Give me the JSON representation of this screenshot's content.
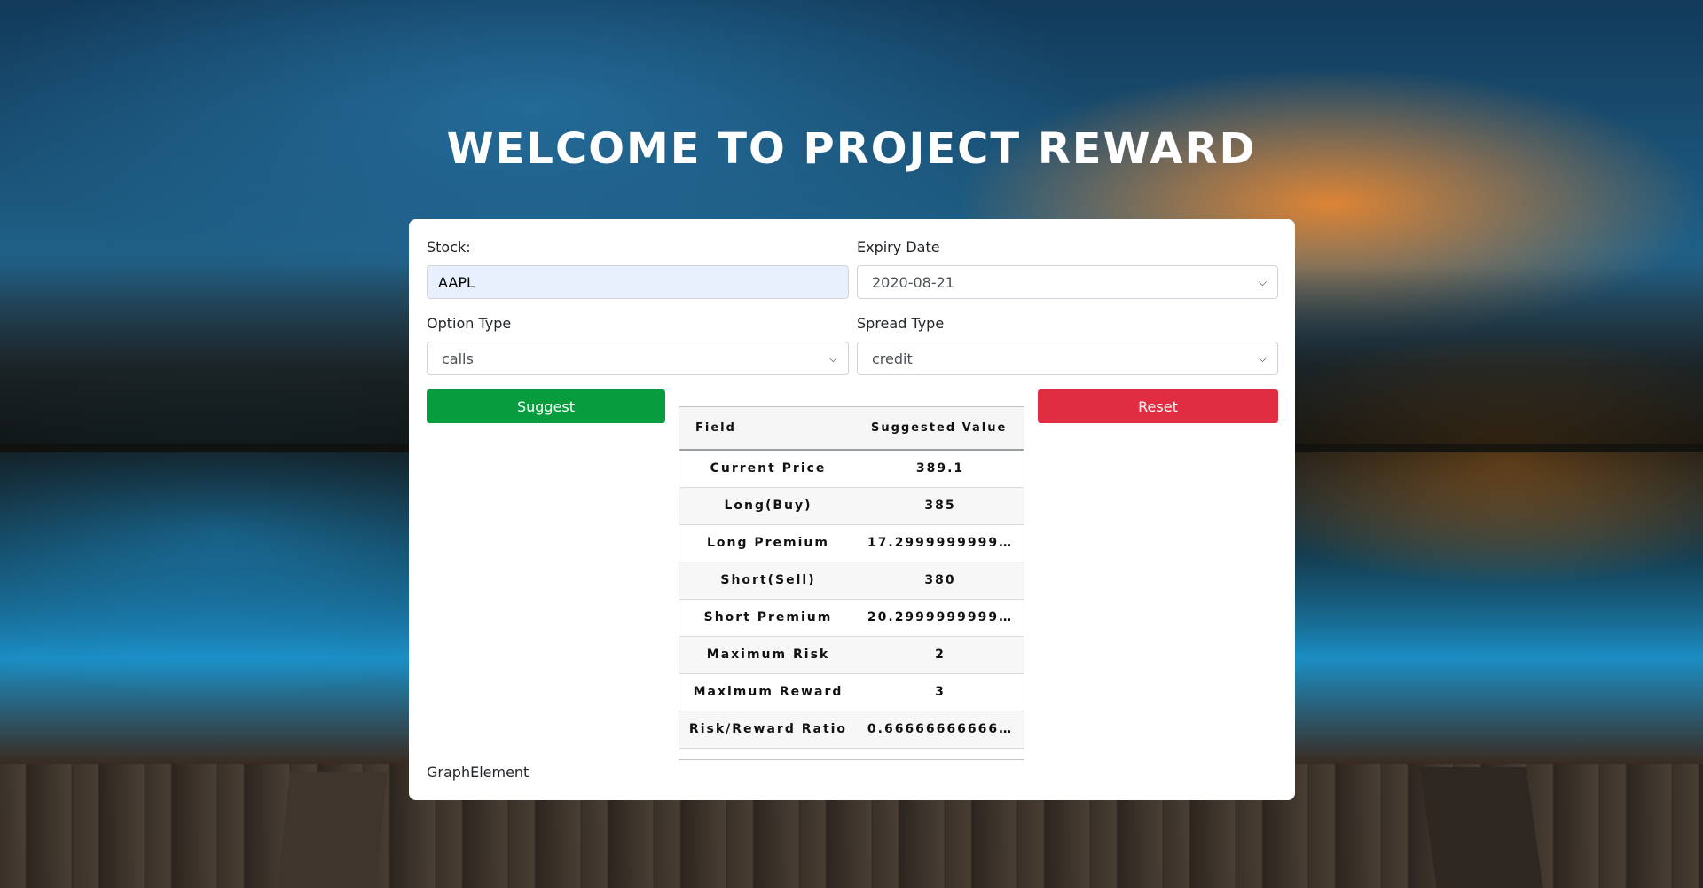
{
  "header": {
    "title": "WELCOME TO PROJECT REWARD"
  },
  "form": {
    "stock_label": "Stock:",
    "stock_value": "AAPL",
    "expiry_label": "Expiry Date",
    "expiry_value": "2020-08-21",
    "option_type_label": "Option Type",
    "option_type_value": "calls",
    "spread_type_label": "Spread Type",
    "spread_type_value": "credit"
  },
  "buttons": {
    "suggest": "Suggest",
    "reset": "Reset"
  },
  "table": {
    "headers": [
      "Field",
      "Suggested Value"
    ],
    "rows": [
      [
        "Current Price",
        "389.1"
      ],
      [
        "Long(Buy)",
        "385"
      ],
      [
        "Long Premium",
        "17.2999999999…"
      ],
      [
        "Short(Sell)",
        "380"
      ],
      [
        "Short Premium",
        "20.2999999999…"
      ],
      [
        "Maximum Risk",
        "2"
      ],
      [
        "Maximum Reward",
        "3"
      ],
      [
        "Risk/Reward Ratio",
        "0.66666666666…"
      ]
    ]
  },
  "graph": {
    "label": "GraphElement"
  },
  "colors": {
    "suggest": "#079c3d",
    "reset": "#e02d41",
    "card": "#ffffff"
  },
  "icons": {
    "select": "chevron-down-icon"
  }
}
